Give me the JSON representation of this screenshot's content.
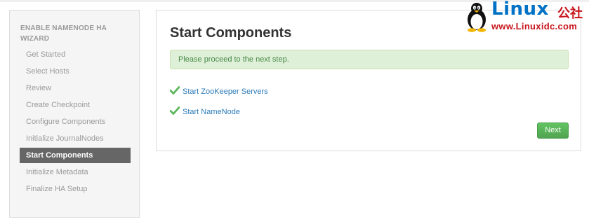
{
  "sidebar": {
    "title": "ENABLE NAMENODE HA WIZARD",
    "items": [
      {
        "label": "Get Started",
        "active": false
      },
      {
        "label": "Select Hosts",
        "active": false
      },
      {
        "label": "Review",
        "active": false
      },
      {
        "label": "Create Checkpoint",
        "active": false
      },
      {
        "label": "Configure Components",
        "active": false
      },
      {
        "label": "Initialize JournalNodes",
        "active": false
      },
      {
        "label": "Start Components",
        "active": true
      },
      {
        "label": "Initialize Metadata",
        "active": false
      },
      {
        "label": "Finalize HA Setup",
        "active": false
      }
    ]
  },
  "main": {
    "title": "Start Components",
    "alert": "Please proceed to the next step.",
    "tasks": [
      {
        "label": "Start ZooKeeper Servers",
        "status": "completed",
        "icon": "check-icon"
      },
      {
        "label": "Start NameNode",
        "status": "completed",
        "icon": "check-icon"
      }
    ],
    "next_label": "Next"
  },
  "watermark": {
    "brand": "Linux",
    "brand_cn": "公社",
    "url": "www.Linuxidc.com",
    "icon": "tux-icon"
  },
  "colors": {
    "sidebar_active_bg": "#666666",
    "alert_bg": "#dff0d8",
    "alert_text": "#468847",
    "link": "#2a7ab8",
    "check": "#5cb85c",
    "button_green": "#51a351",
    "watermark_blue": "#0072c6",
    "watermark_red": "#c8161d"
  }
}
